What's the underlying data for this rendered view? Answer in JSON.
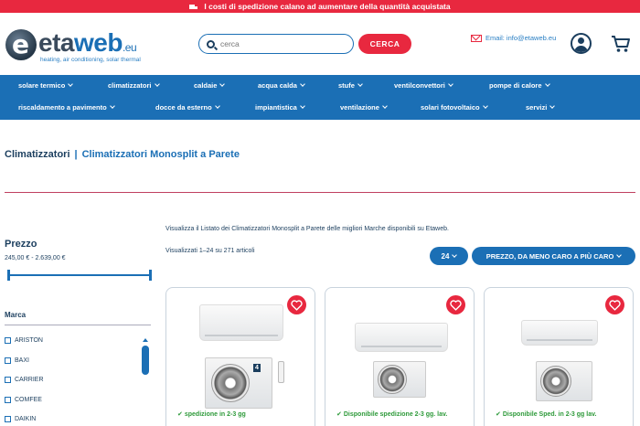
{
  "topbar": {
    "text": "I costi di spedizione calano ad aumentare della quantità acquistata"
  },
  "logo": {
    "part1": "eta",
    "part2": "web",
    "part3": ".eu",
    "tagline": "heating, air conditioning, solar thermal"
  },
  "search": {
    "placeholder": "cerca",
    "button": "CERCA"
  },
  "contact": {
    "email": "Email: info@etaweb.eu"
  },
  "nav": {
    "row1": [
      "solare termico",
      "climatizzatori",
      "caldaie",
      "acqua calda",
      "stufe",
      "ventilconvettori",
      "pompe di calore"
    ],
    "row2": [
      "riscaldamento a pavimento",
      "docce da esterno",
      "impiantistica",
      "ventilazione",
      "solari fotovoltaico",
      "servizi"
    ]
  },
  "breadcrumb": {
    "parent": "Climatizzatori",
    "separator": "|",
    "current": "Climatizzatori Monosplit a Parete"
  },
  "filters": {
    "price_title": "Prezzo",
    "price_range": "245,00 € - 2.639,00 €",
    "brand_title": "Marca",
    "brands": [
      "ARISTON",
      "BAXI",
      "CARRIER",
      "COMFEE",
      "DAIKIN"
    ]
  },
  "listing": {
    "intro": "Visualizza il Listato dei Climatizzatori Monosplit a Parete delle migliori Marche disponibili su Etaweb.",
    "count": "Visualizzati 1–24 su 271 articoli",
    "per_page": "24",
    "sort": "PREZZO, DA MENO CARO A PIÙ CARO"
  },
  "products": [
    {
      "status": "spedizione in 2-3 gg"
    },
    {
      "status": "Disponibile spedizione 2-3 gg. lav."
    },
    {
      "status": "Disponibile Sped. in 2-3 gg lav."
    }
  ],
  "colors": {
    "accent_red": "#e8283f",
    "brand_blue": "#1b6fb5",
    "navy": "#1b3e5e",
    "stock_green": "#2e9a3a"
  },
  "icons": [
    "truck-icon",
    "search-icon",
    "email-icon",
    "user-icon",
    "cart-icon",
    "heart-icon",
    "check-icon",
    "chevron-down-icon"
  ]
}
